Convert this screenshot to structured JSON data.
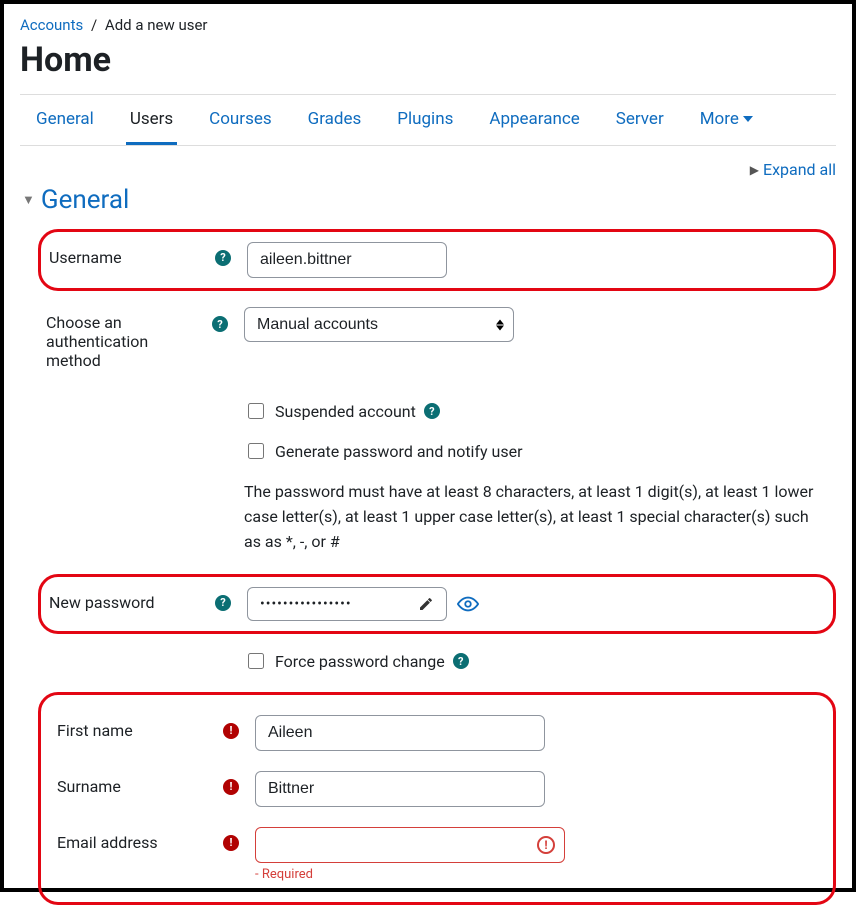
{
  "breadcrumb": {
    "root_label": "Accounts",
    "current_label": "Add a new user"
  },
  "page_title": "Home",
  "tabs": {
    "items": [
      {
        "label": "General"
      },
      {
        "label": "Users"
      },
      {
        "label": "Courses"
      },
      {
        "label": "Grades"
      },
      {
        "label": "Plugins"
      },
      {
        "label": "Appearance"
      },
      {
        "label": "Server"
      },
      {
        "label": "More"
      }
    ],
    "active_index": 1
  },
  "expand_all_label": "Expand all",
  "section": {
    "title": "General"
  },
  "fields": {
    "username": {
      "label": "Username",
      "value": "aileen.bittner"
    },
    "auth_method": {
      "label": "Choose an authentication method",
      "selected": "Manual accounts"
    },
    "suspended": {
      "label": "Suspended account",
      "checked": false
    },
    "generate_pw": {
      "label": "Generate password and notify user",
      "checked": false
    },
    "pw_hint": "The password must have at least 8 characters, at least 1 digit(s), at least 1 lower case letter(s), at least 1 upper case letter(s), at least 1 special character(s) such as as *, -, or #",
    "new_password": {
      "label": "New password",
      "masked": "••••••••••••••••"
    },
    "force_change": {
      "label": "Force password change",
      "checked": false
    },
    "first_name": {
      "label": "First name",
      "value": "Aileen"
    },
    "surname": {
      "label": "Surname",
      "value": "Bittner"
    },
    "email": {
      "label": "Email address",
      "value": "",
      "error": "- Required"
    }
  },
  "icons": {
    "help_glyph": "?",
    "required_glyph": "!",
    "err_glyph": "!"
  }
}
